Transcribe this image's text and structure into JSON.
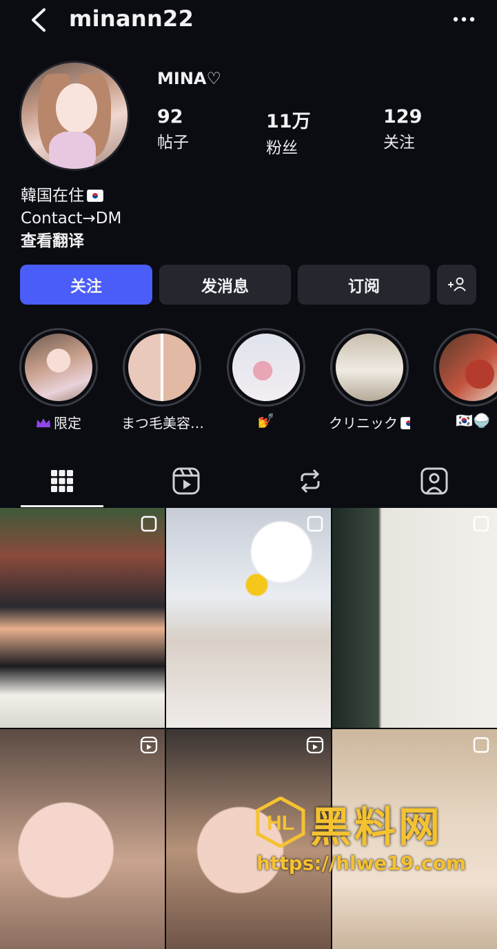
{
  "header": {
    "username": "minann22"
  },
  "profile": {
    "display_name": "MINA♡",
    "stats": [
      {
        "value": "92",
        "label": "帖子"
      },
      {
        "value": "11万",
        "label": "粉丝"
      },
      {
        "value": "129",
        "label": "关注"
      }
    ],
    "bio": {
      "line1": "韓国在住",
      "line2": "Contact→DM",
      "translate": "查看翻译"
    }
  },
  "actions": {
    "follow": "关注",
    "message": "发消息",
    "subscribe": "订阅"
  },
  "highlights": [
    {
      "label": "限定",
      "icon": "crown-icon"
    },
    {
      "label": "まつ毛美容…"
    },
    {
      "label": "💅"
    },
    {
      "label": "クリニック"
    },
    {
      "label": "🇰🇷🍚"
    }
  ],
  "tabs": [
    "grid-icon",
    "reels-icon",
    "reposts-icon",
    "tagged-icon"
  ],
  "grid_badges": [
    "multi-photo-icon",
    "multi-photo-icon",
    "multi-photo-icon",
    "reel-icon",
    "reel-icon",
    "multi-photo-icon"
  ],
  "watermark": {
    "title": "黑料网",
    "url": "https://hlwe19.com"
  },
  "colors": {
    "background": "#0b0c11",
    "primary_button": "#4a5df9",
    "secondary_button": "#25272e",
    "watermark": "#f5c231"
  }
}
